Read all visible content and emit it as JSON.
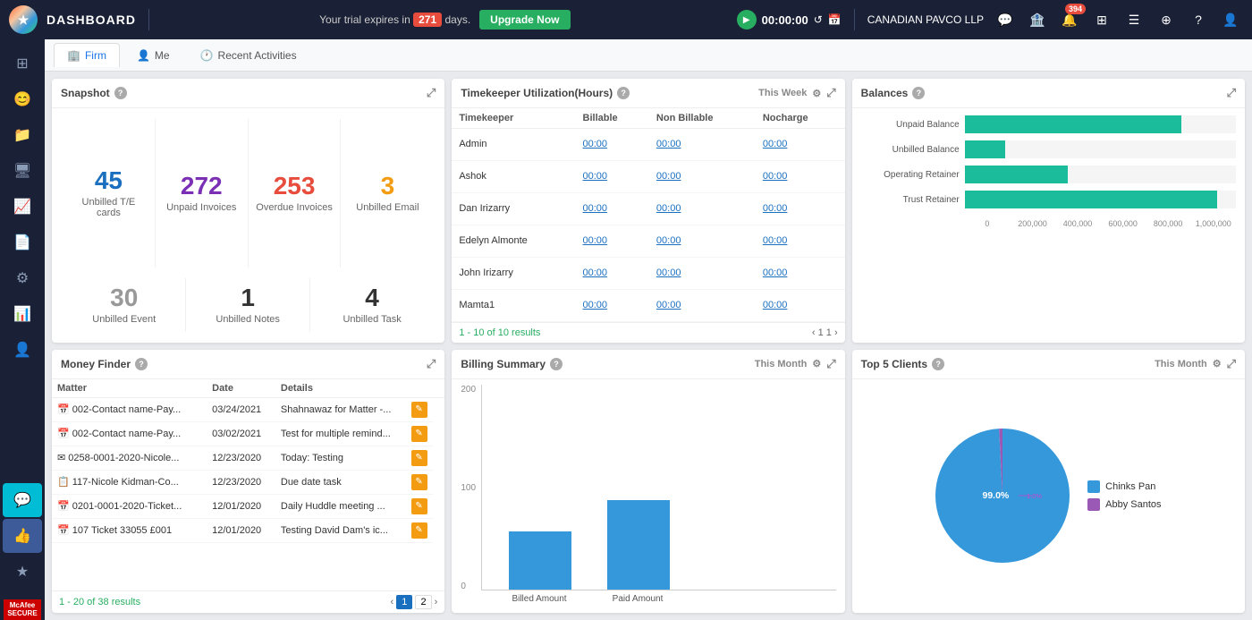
{
  "topNav": {
    "title": "DASHBOARD",
    "trialText": "Your trial expires in",
    "days": "271",
    "daysUnit": "days.",
    "upgradeLabel": "Upgrade Now",
    "timer": "00:00:00",
    "clientName": "CANADIAN PAVCO LLP",
    "notificationCount": "394"
  },
  "tabs": [
    {
      "id": "firm",
      "label": "Firm",
      "icon": "🏢",
      "active": true
    },
    {
      "id": "me",
      "label": "Me",
      "icon": "👤",
      "active": false
    },
    {
      "id": "recent",
      "label": "Recent Activities",
      "icon": "🕐",
      "active": false
    }
  ],
  "snapshot": {
    "title": "Snapshot",
    "row1": [
      {
        "value": "45",
        "label": "Unbilled T/E cards",
        "color": "color-blue"
      },
      {
        "value": "272",
        "label": "Unpaid Invoices",
        "color": "color-purple"
      },
      {
        "value": "253",
        "label": "Overdue Invoices",
        "color": "color-red"
      },
      {
        "value": "3",
        "label": "Unbilled Email",
        "color": "color-orange"
      }
    ],
    "row2": [
      {
        "value": "30",
        "label": "Unbilled Event",
        "color": "color-gray"
      },
      {
        "value": "1",
        "label": "Unbilled Notes",
        "color": "color-dark"
      },
      {
        "value": "4",
        "label": "Unbilled Task",
        "color": "color-dark"
      }
    ]
  },
  "timekeeper": {
    "title": "Timekeeper Utilization(Hours)",
    "period": "This Week",
    "columns": [
      "Timekeeper",
      "Billable",
      "Non Billable",
      "Nocharge"
    ],
    "rows": [
      {
        "name": "Admin",
        "billable": "00:00",
        "nonBillable": "00:00",
        "nocharge": "00:00"
      },
      {
        "name": "Ashok",
        "billable": "00:00",
        "nonBillable": "00:00",
        "nocharge": "00:00"
      },
      {
        "name": "Dan Irizarry",
        "billable": "00:00",
        "nonBillable": "00:00",
        "nocharge": "00:00"
      },
      {
        "name": "Edelyn Almonte",
        "billable": "00:00",
        "nonBillable": "00:00",
        "nocharge": "00:00"
      },
      {
        "name": "John Irizarry",
        "billable": "00:00",
        "nonBillable": "00:00",
        "nocharge": "00:00"
      },
      {
        "name": "Mamta1",
        "billable": "00:00",
        "nonBillable": "00:00",
        "nocharge": "00:00"
      }
    ],
    "pagination": "1 - 10 of 10 results"
  },
  "balances": {
    "title": "Balances",
    "bars": [
      {
        "label": "Unpaid Balance",
        "value": 80,
        "maxWidth": 100
      },
      {
        "label": "Unbilled Balance",
        "value": 15,
        "maxWidth": 100
      },
      {
        "label": "Operating Retainer",
        "value": 35,
        "maxWidth": 100
      },
      {
        "label": "Trust Retainer",
        "value": 92,
        "maxWidth": 100
      }
    ],
    "xAxis": [
      "0",
      "200,000",
      "400,000",
      "600,000",
      "800,000",
      "1,000,000"
    ]
  },
  "moneyFinder": {
    "title": "Money Finder",
    "columns": [
      "Matter",
      "Date",
      "Details"
    ],
    "rows": [
      {
        "type": "cal",
        "matter": "002-Contact name-Pay...",
        "date": "03/24/2021",
        "details": "Shahnawaz for Matter -..."
      },
      {
        "type": "cal",
        "matter": "002-Contact name-Pay...",
        "date": "03/02/2021",
        "details": "Test for multiple remind..."
      },
      {
        "type": "email",
        "matter": "0258-0001-2020-Nicole...",
        "date": "12/23/2020",
        "details": "Today: Testing"
      },
      {
        "type": "task",
        "matter": "117-Nicole Kidman-Co...",
        "date": "12/23/2020",
        "details": "Due date task"
      },
      {
        "type": "cal",
        "matter": "0201-0001-2020-Ticket...",
        "date": "12/01/2020",
        "details": "Daily Huddle meeting ..."
      },
      {
        "type": "cal",
        "matter": "107 Ticket 33055 £001",
        "date": "12/01/2020",
        "details": "Testing David Dam's ic..."
      }
    ],
    "resultText": "1 - 20 of 38 results",
    "pages": [
      "1",
      "2"
    ]
  },
  "billingSummary": {
    "title": "Billing Summary",
    "period": "This Month",
    "yLabels": [
      "200",
      "100",
      "0"
    ],
    "bars": [
      {
        "label": "Billed Amount",
        "height": 65,
        "maxHeight": 130
      },
      {
        "label": "Paid Amount",
        "height": 100,
        "maxHeight": 130
      }
    ]
  },
  "topClients": {
    "title": "Top 5 Clients",
    "period": "This Month",
    "legend": [
      {
        "label": "Chinks Pan",
        "color": "#3498db",
        "percent": "99.0%"
      },
      {
        "label": "Abby Santos",
        "color": "#9b59b6",
        "percent": "1.0%"
      }
    ]
  },
  "sidebar": {
    "items": [
      {
        "id": "dashboard",
        "icon": "⊞",
        "active": false
      },
      {
        "id": "clients",
        "icon": "😊",
        "active": false
      },
      {
        "id": "folder",
        "icon": "📁",
        "active": false
      },
      {
        "id": "monitor",
        "icon": "🖥",
        "active": false
      },
      {
        "id": "chart",
        "icon": "📈",
        "active": false
      },
      {
        "id": "billing",
        "icon": "📄",
        "active": false
      },
      {
        "id": "settings",
        "icon": "⚙",
        "active": false
      },
      {
        "id": "reports",
        "icon": "📊",
        "active": false
      },
      {
        "id": "contacts",
        "icon": "👤",
        "active": false
      }
    ]
  }
}
